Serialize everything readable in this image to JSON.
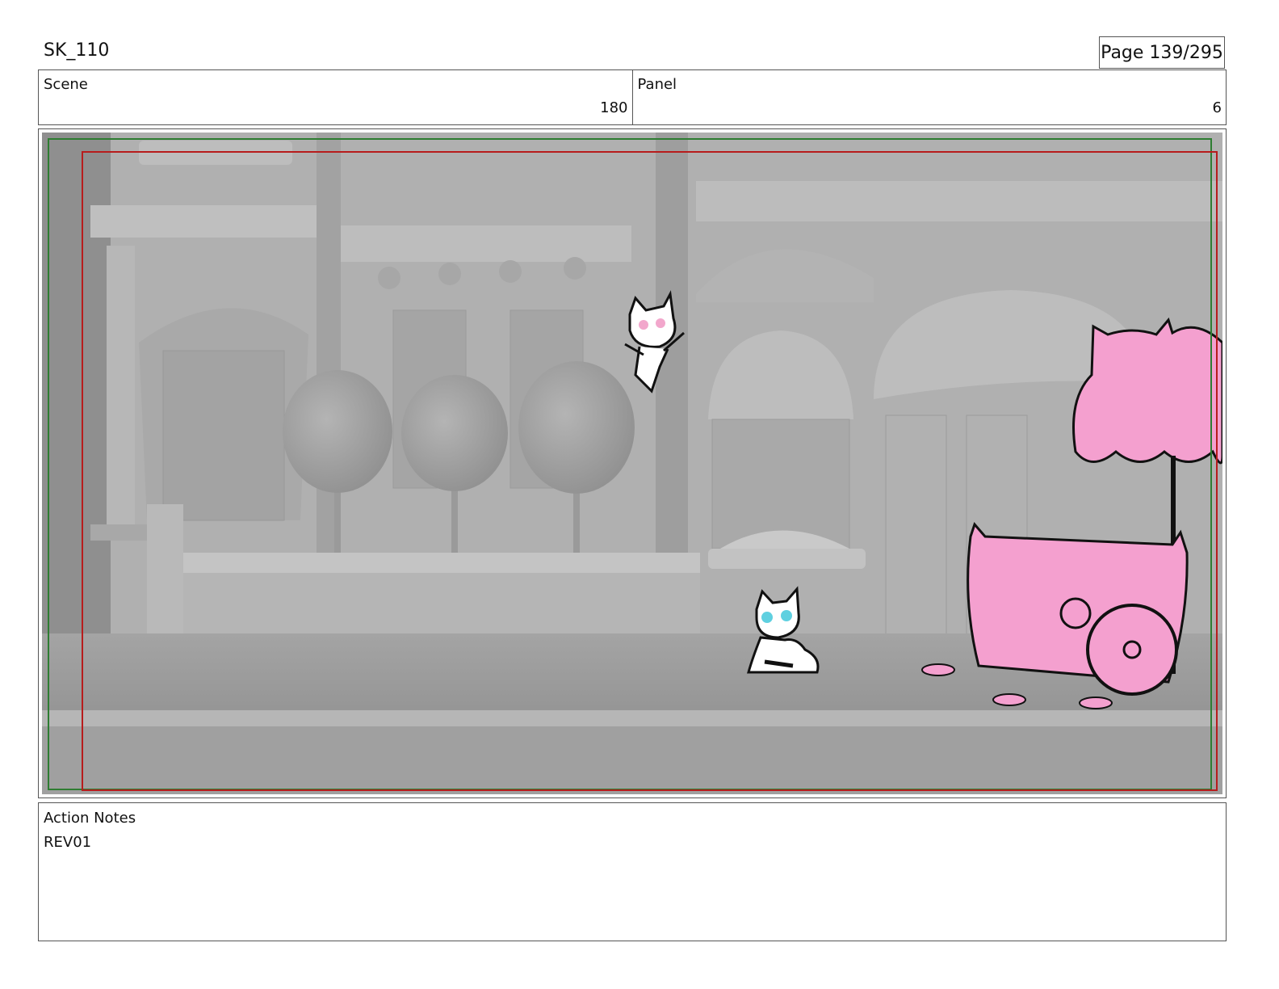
{
  "header": {
    "project": "SK_110",
    "page": "Page 139/295"
  },
  "info": {
    "scene_label": "Scene",
    "scene_value": "180",
    "panel_label": "Panel",
    "panel_value": "6"
  },
  "panel": {
    "description_icons": [
      "street-background",
      "jumping-cat-character",
      "sitting-cat-character",
      "pink-flower-cart",
      "safe-frame-green",
      "action-frame-red"
    ]
  },
  "notes": {
    "label": "Action Notes",
    "text": "REV01"
  },
  "colors": {
    "border": "#555555",
    "safe_frame": "#2e7d32",
    "action_frame": "#b71c1c",
    "cart_pink": "#f4a0cf"
  }
}
